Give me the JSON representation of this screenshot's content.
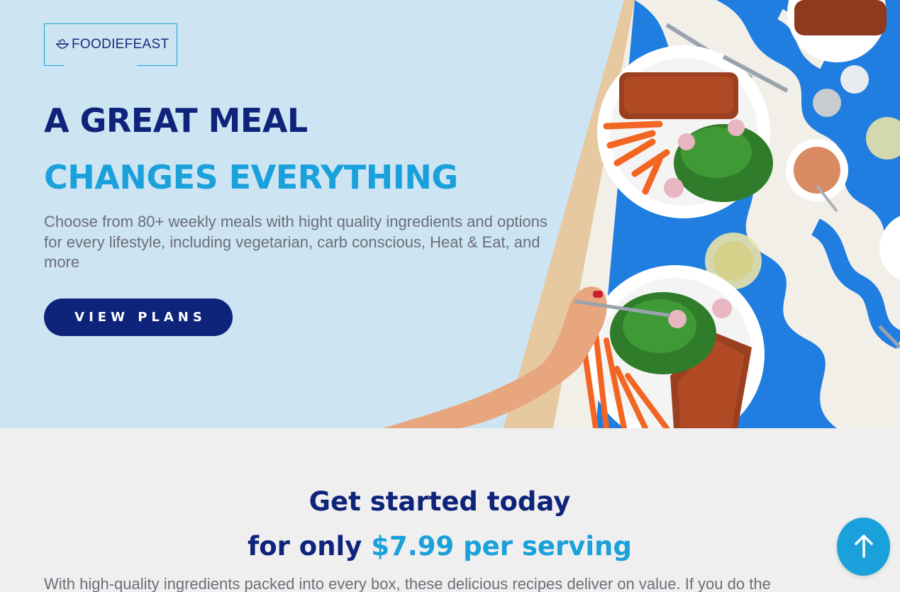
{
  "brand": {
    "name": "FOODIEFEAST",
    "icon": "bowl-icon"
  },
  "hero": {
    "headline_line1": "A GREAT MEAL",
    "headline_line2": "CHANGES EVERYTHING",
    "subtext": "Choose from 80+ weekly meals with hight quality ingredients and options for every lifestyle, including vegetarian, carb conscious, Heat & Eat, and more",
    "cta_label": "VIEW PLANS"
  },
  "intro": {
    "heading_line1": "Get started today",
    "heading_line2_prefix": "for only ",
    "heading_line2_accent": "$7.99 per serving",
    "body": "With high-quality ingredients packed into every box, these delicious recipes deliver on value. If you do the"
  },
  "fab": {
    "icon": "arrow-up-icon"
  },
  "colors": {
    "navy": "#0e237a",
    "accent": "#1aa0db",
    "hero_bg": "#cde4f2",
    "section_bg": "#efefef"
  }
}
